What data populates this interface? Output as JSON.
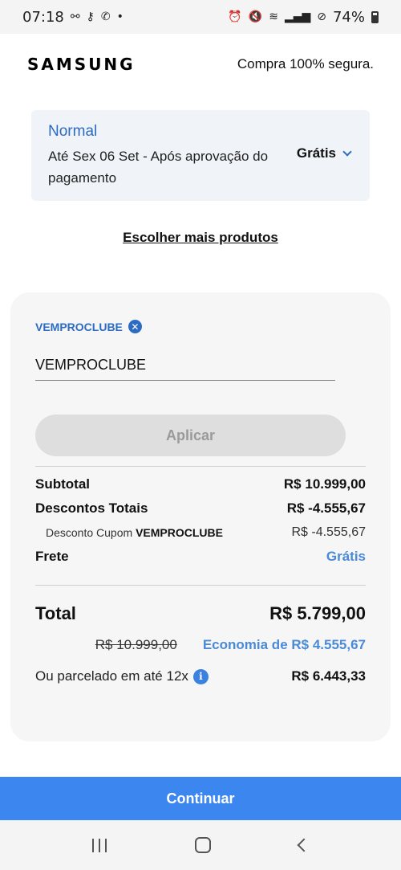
{
  "status_bar": {
    "time": "07:18",
    "battery": "74%",
    "left_icons": [
      "link-icon",
      "key-icon",
      "whatsapp-icon",
      "dot-icon"
    ],
    "right_icons": [
      "alarm-icon",
      "mute-icon",
      "wifi-icon",
      "volte-icon",
      "signal-icon",
      "dnd-icon",
      "battery-icon"
    ]
  },
  "header": {
    "brand": "SAMSUNG",
    "secure_text": "Compra 100% segura."
  },
  "shipping": {
    "name": "Normal",
    "description": "Até Sex 06 Set - Após aprovação do pagamento",
    "price": "Grátis"
  },
  "more_products_link": "Escolher mais produtos",
  "coupon": {
    "applied_code": "VEMPROCLUBE",
    "input_value": "VEMPROCLUBE",
    "apply_label": "Aplicar"
  },
  "summary": {
    "subtotal_label": "Subtotal",
    "subtotal_value": "R$ 10.999,00",
    "discounts_label": "Descontos Totais",
    "discounts_value": "R$ -4.555,67",
    "coupon_discount_prefix": "Desconto Cupom",
    "coupon_discount_code": "VEMPROCLUBE",
    "coupon_discount_value": "R$ -4.555,67",
    "shipping_label": "Frete",
    "shipping_value": "Grátis",
    "total_label": "Total",
    "total_value": "R$ 5.799,00",
    "old_price": "R$ 10.999,00",
    "savings": "Economia de R$ 4.555,67",
    "installment_label": "Ou parcelado em até 12x",
    "installment_value": "R$ 6.443,33"
  },
  "continue_label": "Continuar",
  "colors": {
    "accent_blue": "#2b6cc2",
    "light_blue": "#4a8ad6",
    "button_blue": "#3b87ef"
  }
}
